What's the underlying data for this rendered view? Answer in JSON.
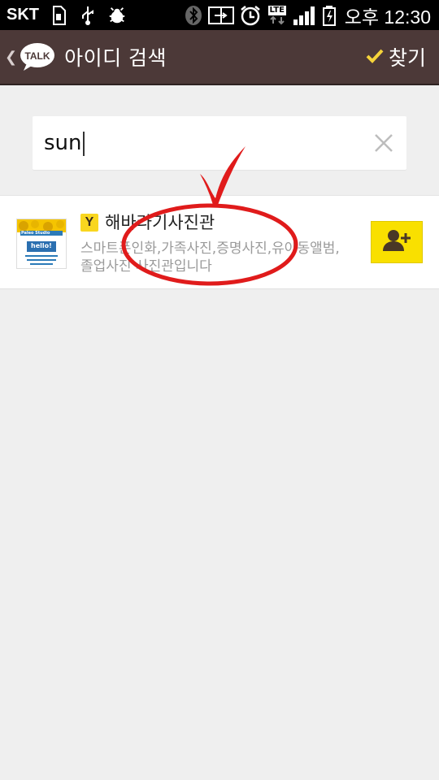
{
  "status_bar": {
    "carrier": "SKT",
    "lte_label": "LTE",
    "time": "오후 12:30"
  },
  "app_bar": {
    "logo_text": "TALK",
    "title": "아이디 검색",
    "find_label": "찾기"
  },
  "search": {
    "value": "sun"
  },
  "result": {
    "thumb_text_top": "hello!",
    "thumb_text_brand": "Paleo Studio",
    "name": "해바라기사진관",
    "badge": "Y",
    "description": "스마트폰인화,가족사진,증명사진,유아동앨범,졸업사진 사진관입니다"
  },
  "colors": {
    "app_bar": "#4c3938",
    "background": "#efefef",
    "accent_yellow": "#f9e000",
    "annotation_red": "#e01b1b"
  }
}
